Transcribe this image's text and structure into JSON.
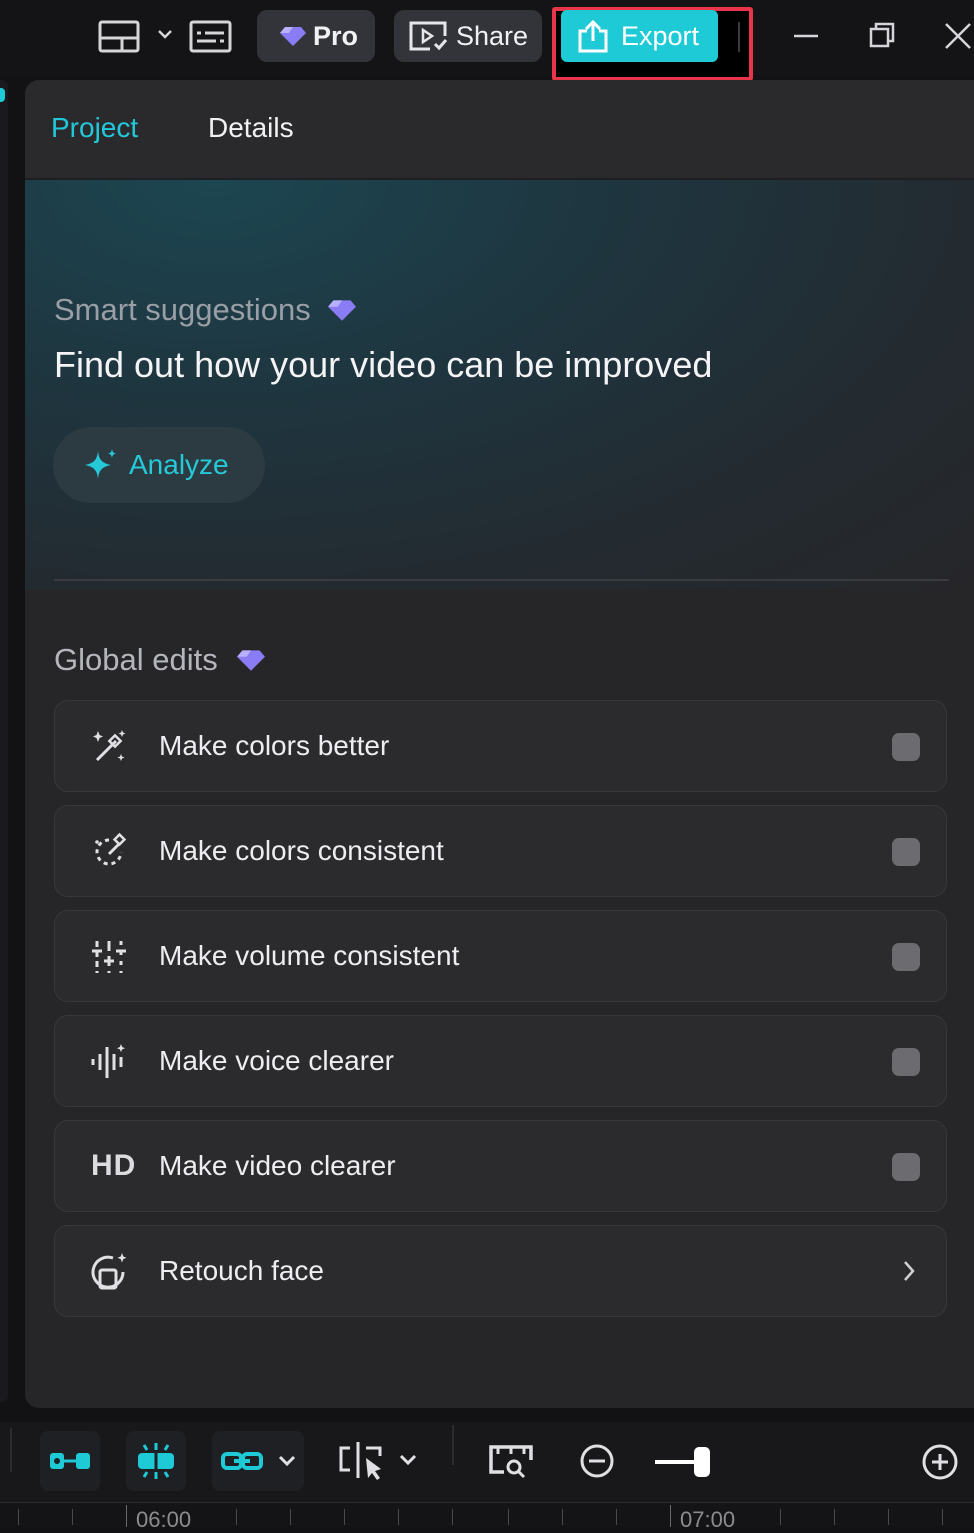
{
  "topbar": {
    "pro_label": "Pro",
    "share_label": "Share",
    "export_label": "Export",
    "icons": [
      "layout-icon",
      "chevron-down-icon",
      "captions-icon",
      "diamond-icon",
      "share-screen-icon",
      "upload-icon",
      "minimize-icon",
      "restore-icon",
      "close-icon"
    ]
  },
  "tabs": [
    {
      "label": "Project",
      "active": true
    },
    {
      "label": "Details",
      "active": false
    }
  ],
  "suggestions": {
    "title": "Smart suggestions",
    "subtitle": "Find out how your video can be improved",
    "analyze_label": "Analyze"
  },
  "global_edits": {
    "title": "Global edits",
    "items": [
      {
        "label": "Make colors better",
        "icon": "magic-wand-icon",
        "control": "toggle",
        "enabled": false
      },
      {
        "label": "Make colors consistent",
        "icon": "color-match-icon",
        "control": "toggle",
        "enabled": false
      },
      {
        "label": "Make volume consistent",
        "icon": "sliders-icon",
        "control": "toggle",
        "enabled": false
      },
      {
        "label": "Make voice clearer",
        "icon": "voice-wave-icon",
        "control": "toggle",
        "enabled": false
      },
      {
        "label": "Make video clearer",
        "icon": "hd-icon",
        "icon_text": "HD",
        "control": "toggle",
        "enabled": false
      },
      {
        "label": "Retouch face",
        "icon": "face-retouch-icon",
        "control": "chevron"
      }
    ]
  },
  "timeline": {
    "ruler_labels": [
      "06:00",
      "07:00"
    ]
  },
  "colors": {
    "accent": "#1ecad6",
    "highlight_outline": "#e9354a",
    "premium_diamond": "#8a7cf5"
  }
}
